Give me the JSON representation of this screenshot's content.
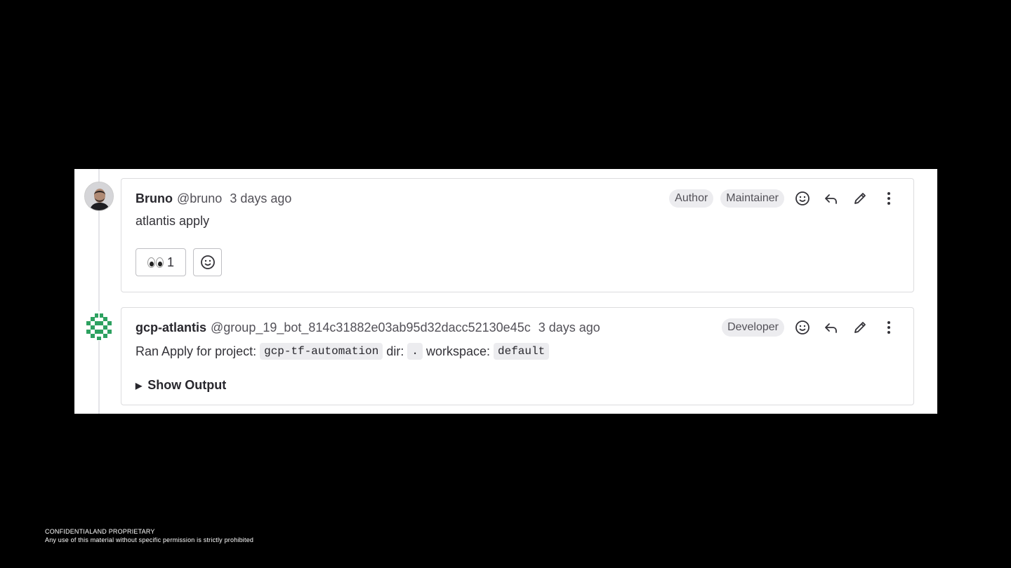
{
  "comments": [
    {
      "author": "Bruno",
      "handle": "@bruno",
      "time": "3 days ago",
      "badges": [
        "Author",
        "Maintainer"
      ],
      "body": "atlantis apply",
      "reactions": [
        {
          "emoji": "eyes",
          "count": "1"
        }
      ],
      "avatar_icon": "user-avatar-photo"
    },
    {
      "author": "gcp-atlantis",
      "handle": "@group_19_bot_814c31882e03ab95d32dacc52130e45c",
      "time": "3 days ago",
      "badges": [
        "Developer"
      ],
      "body_parts": {
        "prefix": "Ran Apply for project:",
        "project": "gcp-tf-automation",
        "dir_label": "dir:",
        "dir": ".",
        "workspace_label": "workspace:",
        "workspace": "default"
      },
      "toggle_label": "Show Output",
      "avatar_icon": "bot-avatar-identicon"
    }
  ],
  "footer": {
    "line1": "CONFIDENTIALAND PROPRIETARY",
    "line2": "Any use of this material without specific permission is strictly prohibited"
  },
  "colors": {
    "background": "#000000",
    "panel": "#ffffff",
    "badge_bg": "#ececef",
    "bot_avatar": "#2da160"
  }
}
